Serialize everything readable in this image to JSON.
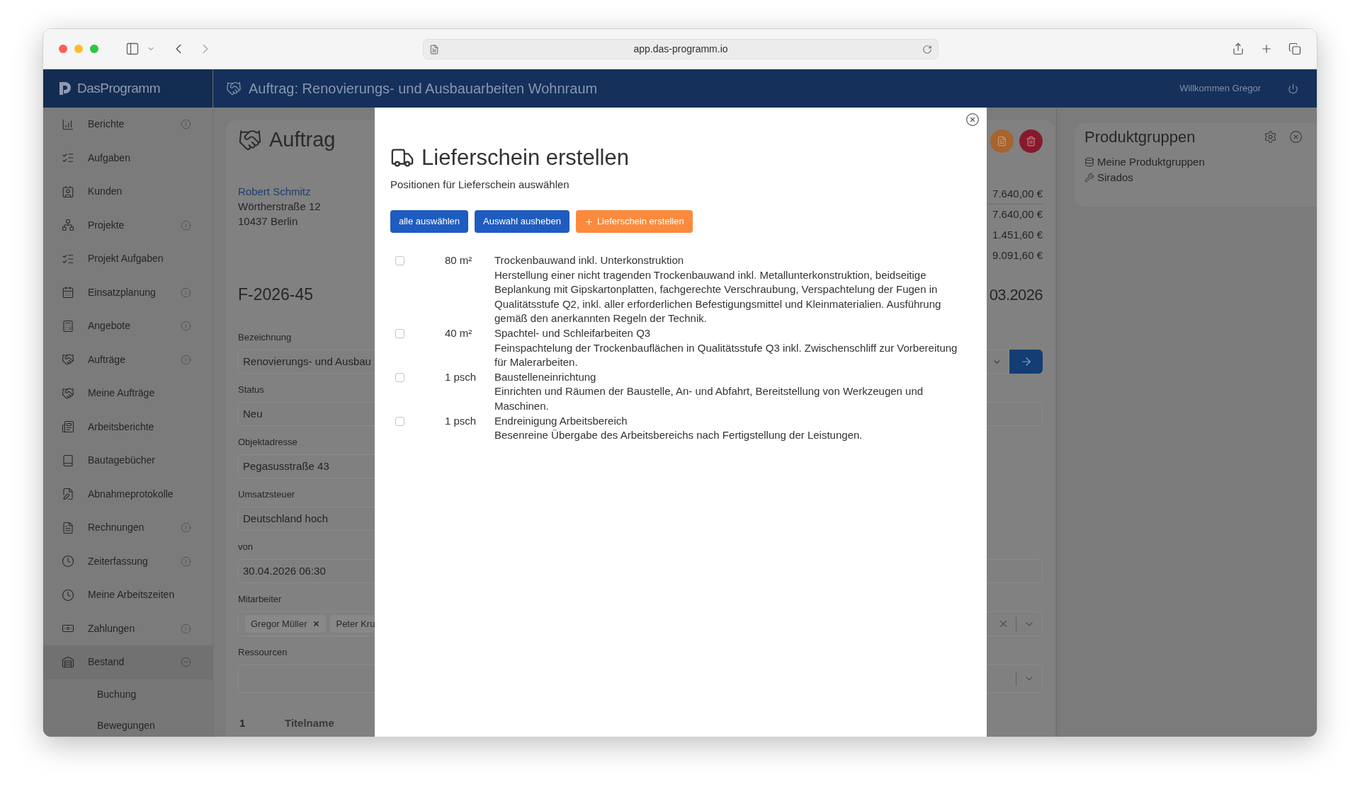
{
  "browser": {
    "url": "app.das-programm.io"
  },
  "app_header": {
    "logo": "DasProgramm",
    "title": "Auftrag: Renovierungs- und Ausbauarbeiten Wohnraum",
    "welcome": "Willkommen Gregor"
  },
  "sidebar": {
    "items": [
      {
        "label": "Berichte",
        "expandable": true,
        "expanded": false
      },
      {
        "label": "Aufgaben",
        "expandable": false
      },
      {
        "label": "Kunden",
        "expandable": false
      },
      {
        "label": "Projekte",
        "expandable": true,
        "expanded": false
      },
      {
        "label": "Projekt Aufgaben",
        "expandable": false
      },
      {
        "label": "Einsatzplanung",
        "expandable": true,
        "expanded": false
      },
      {
        "label": "Angebote",
        "expandable": true,
        "expanded": false
      },
      {
        "label": "Aufträge",
        "expandable": true,
        "expanded": false
      },
      {
        "label": "Meine Aufträge",
        "expandable": false
      },
      {
        "label": "Arbeitsberichte",
        "expandable": false
      },
      {
        "label": "Bautagebücher",
        "expandable": false
      },
      {
        "label": "Abnahmeprotokolle",
        "expandable": false
      },
      {
        "label": "Rechnungen",
        "expandable": true,
        "expanded": false
      },
      {
        "label": "Zeiterfassung",
        "expandable": true,
        "expanded": false
      },
      {
        "label": "Meine Arbeitszeiten",
        "expandable": false
      },
      {
        "label": "Zahlungen",
        "expandable": true,
        "expanded": false
      },
      {
        "label": "Bestand",
        "expandable": true,
        "expanded": true,
        "children": [
          {
            "label": "Buchung"
          },
          {
            "label": "Bewegungen"
          }
        ]
      }
    ]
  },
  "order": {
    "title": "Auftrag",
    "customer": {
      "name": "Robert Schmitz",
      "street": "Wörtherstraße 12",
      "city": "10437 Berlin"
    },
    "totals": [
      "7.640,00 €",
      "7.640,00 €",
      "1.451,60 €",
      "9.091,60 €"
    ],
    "number": "F-2026-45",
    "date": "03.2026",
    "fields": [
      {
        "label": "Bezeichnung",
        "kind": "select_go",
        "value": "Renovierungs- und Ausbau"
      },
      {
        "label": "Status",
        "kind": "wide",
        "value": "Neu"
      },
      {
        "label": "Objektadresse",
        "kind": "short",
        "value": "Pegasusstraße 43"
      },
      {
        "label": "Umsatzsteuer",
        "kind": "short",
        "value": "Deutschland hoch"
      },
      {
        "label": "von",
        "kind": "wide",
        "value": "30.04.2026 06:30"
      },
      {
        "label": "Mitarbeiter",
        "kind": "multi",
        "clearable": true,
        "chips": [
          {
            "label": "Gregor Müller",
            "removable": true
          },
          {
            "label": "Peter Kru",
            "removable": false
          }
        ]
      },
      {
        "label": "Ressourcen",
        "kind": "multi",
        "clearable": false
      }
    ],
    "table_header": {
      "column_1": "1",
      "column_2": "Titelname"
    }
  },
  "product_groups": {
    "title": "Produktgruppen",
    "items": [
      {
        "label": "Meine Produktgruppen"
      },
      {
        "label": "Sirados"
      }
    ]
  },
  "modal": {
    "title": "Lieferschein erstellen",
    "subtitle": "Positionen für Lieferschein auswählen",
    "buttons": [
      {
        "label": "alle auswählen",
        "kind": "primary"
      },
      {
        "label": "Auswahl ausheben",
        "kind": "primary"
      },
      {
        "label": "Lieferschein erstellen",
        "kind": "accent"
      }
    ],
    "positions": [
      {
        "checked": false,
        "quantity": "80 m²",
        "title": "Trockenbauwand inkl. Unterkonstruktion",
        "description": "Herstellung einer nicht tragenden Trockenbauwand inkl. Metallunterkonstruktion, beidseitige Beplankung mit Gipskartonplatten, fachgerechte Verschraubung, Verspachtelung der Fugen in Qualitätsstufe Q2, inkl. aller erforderlichen Befestigungsmittel und Kleinmaterialien. Ausführung gemäß den anerkannten Regeln der Technik."
      },
      {
        "checked": false,
        "quantity": "40 m²",
        "title": "Spachtel- und Schleifarbeiten Q3",
        "description": "Feinspachtelung der Trockenbauflächen in Qualitätsstufe Q3 inkl. Zwischenschliff zur Vorbereitung für Malerarbeiten."
      },
      {
        "checked": false,
        "quantity": "1 psch",
        "title": "Baustelleneinrichtung",
        "description": "Einrichten und Räumen der Baustelle, An- und Abfahrt, Bereitstellung von Werkzeugen und Maschinen."
      },
      {
        "checked": false,
        "quantity": "1 psch",
        "title": "Endreinigung Arbeitsbereich",
        "description": "Besenreine Übergabe des Arbeitsbereichs nach Fertigstellung der Leistungen."
      }
    ]
  }
}
